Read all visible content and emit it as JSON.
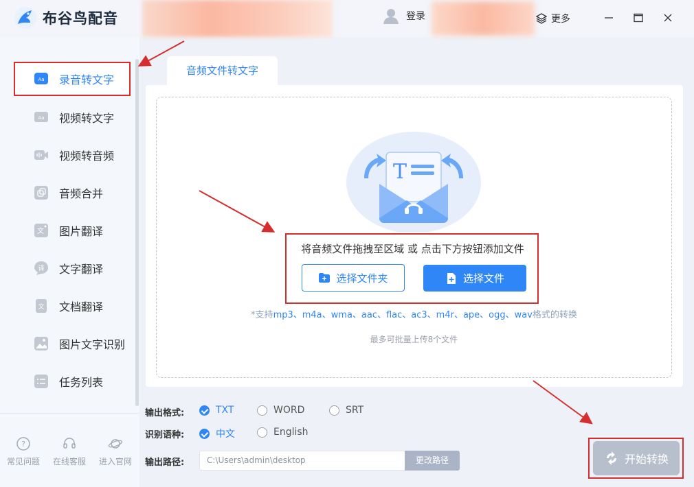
{
  "app": {
    "name": "布谷鸟配音",
    "login_label": "登录",
    "more_label": "更多"
  },
  "sidebar": {
    "items": [
      {
        "label": "录音转文字",
        "icon": "aa-text-icon",
        "active": true
      },
      {
        "label": "视频转文字",
        "icon": "aa-video-icon"
      },
      {
        "label": "视频转音频",
        "icon": "video-audio-icon"
      },
      {
        "label": "音频合并",
        "icon": "merge-icon"
      },
      {
        "label": "图片翻译",
        "icon": "image-translate-icon"
      },
      {
        "label": "文字翻译",
        "icon": "text-translate-icon"
      },
      {
        "label": "文档翻译",
        "icon": "doc-translate-icon"
      },
      {
        "label": "图片文字识别",
        "icon": "ocr-icon"
      },
      {
        "label": "任务列表",
        "icon": "task-list-icon"
      }
    ],
    "footer": [
      {
        "label": "常见问题",
        "icon": "help-icon"
      },
      {
        "label": "在线客服",
        "icon": "headset-icon"
      },
      {
        "label": "进入官网",
        "icon": "planet-icon"
      }
    ]
  },
  "main": {
    "tab_label": "音频文件转文字",
    "drop_hint": "将音频文件拖拽至区域 或 点击下方按钮添加文件",
    "select_folder_label": "选择文件夹",
    "select_file_label": "选择文件",
    "support_prefix": "*支持",
    "support_formats": "mp3、m4a、wma、aac、flac、ac3、m4r、ape、ogg、wav",
    "support_suffix": "格式的转换",
    "max_files": "最多可批量上传8个文件"
  },
  "options": {
    "format_label": "输出格式:",
    "formats": [
      "TXT",
      "WORD",
      "SRT"
    ],
    "format_selected": "TXT",
    "language_label": "识别语种:",
    "languages": [
      "中文",
      "English"
    ],
    "language_selected": "中文",
    "path_label": "输出路径:",
    "path_value": "C:\\Users\\admin\\desktop",
    "change_path_label": "更改路径"
  },
  "start_label": "开始转换",
  "colors": {
    "accent": "#2f86f6",
    "highlight_red": "#d62e2e",
    "disabled_button": "#b7bfcd"
  }
}
